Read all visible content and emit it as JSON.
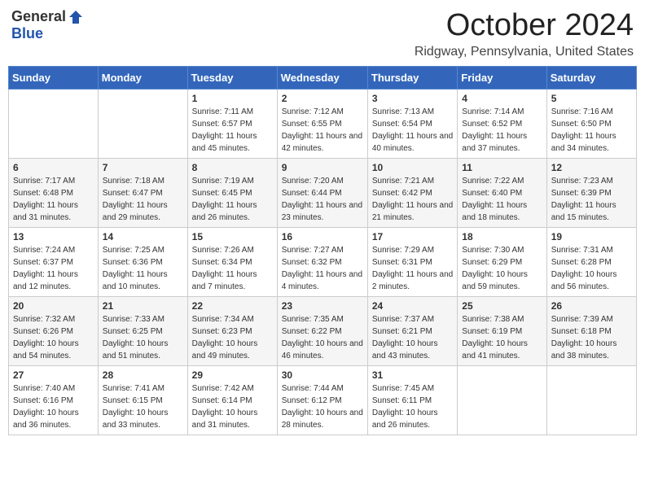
{
  "header": {
    "logo_general": "General",
    "logo_blue": "Blue",
    "month": "October 2024",
    "location": "Ridgway, Pennsylvania, United States"
  },
  "days_of_week": [
    "Sunday",
    "Monday",
    "Tuesday",
    "Wednesday",
    "Thursday",
    "Friday",
    "Saturday"
  ],
  "weeks": [
    [
      {
        "day": "",
        "sunrise": "",
        "sunset": "",
        "daylight": ""
      },
      {
        "day": "",
        "sunrise": "",
        "sunset": "",
        "daylight": ""
      },
      {
        "day": "1",
        "sunrise": "Sunrise: 7:11 AM",
        "sunset": "Sunset: 6:57 PM",
        "daylight": "Daylight: 11 hours and 45 minutes."
      },
      {
        "day": "2",
        "sunrise": "Sunrise: 7:12 AM",
        "sunset": "Sunset: 6:55 PM",
        "daylight": "Daylight: 11 hours and 42 minutes."
      },
      {
        "day": "3",
        "sunrise": "Sunrise: 7:13 AM",
        "sunset": "Sunset: 6:54 PM",
        "daylight": "Daylight: 11 hours and 40 minutes."
      },
      {
        "day": "4",
        "sunrise": "Sunrise: 7:14 AM",
        "sunset": "Sunset: 6:52 PM",
        "daylight": "Daylight: 11 hours and 37 minutes."
      },
      {
        "day": "5",
        "sunrise": "Sunrise: 7:16 AM",
        "sunset": "Sunset: 6:50 PM",
        "daylight": "Daylight: 11 hours and 34 minutes."
      }
    ],
    [
      {
        "day": "6",
        "sunrise": "Sunrise: 7:17 AM",
        "sunset": "Sunset: 6:48 PM",
        "daylight": "Daylight: 11 hours and 31 minutes."
      },
      {
        "day": "7",
        "sunrise": "Sunrise: 7:18 AM",
        "sunset": "Sunset: 6:47 PM",
        "daylight": "Daylight: 11 hours and 29 minutes."
      },
      {
        "day": "8",
        "sunrise": "Sunrise: 7:19 AM",
        "sunset": "Sunset: 6:45 PM",
        "daylight": "Daylight: 11 hours and 26 minutes."
      },
      {
        "day": "9",
        "sunrise": "Sunrise: 7:20 AM",
        "sunset": "Sunset: 6:44 PM",
        "daylight": "Daylight: 11 hours and 23 minutes."
      },
      {
        "day": "10",
        "sunrise": "Sunrise: 7:21 AM",
        "sunset": "Sunset: 6:42 PM",
        "daylight": "Daylight: 11 hours and 21 minutes."
      },
      {
        "day": "11",
        "sunrise": "Sunrise: 7:22 AM",
        "sunset": "Sunset: 6:40 PM",
        "daylight": "Daylight: 11 hours and 18 minutes."
      },
      {
        "day": "12",
        "sunrise": "Sunrise: 7:23 AM",
        "sunset": "Sunset: 6:39 PM",
        "daylight": "Daylight: 11 hours and 15 minutes."
      }
    ],
    [
      {
        "day": "13",
        "sunrise": "Sunrise: 7:24 AM",
        "sunset": "Sunset: 6:37 PM",
        "daylight": "Daylight: 11 hours and 12 minutes."
      },
      {
        "day": "14",
        "sunrise": "Sunrise: 7:25 AM",
        "sunset": "Sunset: 6:36 PM",
        "daylight": "Daylight: 11 hours and 10 minutes."
      },
      {
        "day": "15",
        "sunrise": "Sunrise: 7:26 AM",
        "sunset": "Sunset: 6:34 PM",
        "daylight": "Daylight: 11 hours and 7 minutes."
      },
      {
        "day": "16",
        "sunrise": "Sunrise: 7:27 AM",
        "sunset": "Sunset: 6:32 PM",
        "daylight": "Daylight: 11 hours and 4 minutes."
      },
      {
        "day": "17",
        "sunrise": "Sunrise: 7:29 AM",
        "sunset": "Sunset: 6:31 PM",
        "daylight": "Daylight: 11 hours and 2 minutes."
      },
      {
        "day": "18",
        "sunrise": "Sunrise: 7:30 AM",
        "sunset": "Sunset: 6:29 PM",
        "daylight": "Daylight: 10 hours and 59 minutes."
      },
      {
        "day": "19",
        "sunrise": "Sunrise: 7:31 AM",
        "sunset": "Sunset: 6:28 PM",
        "daylight": "Daylight: 10 hours and 56 minutes."
      }
    ],
    [
      {
        "day": "20",
        "sunrise": "Sunrise: 7:32 AM",
        "sunset": "Sunset: 6:26 PM",
        "daylight": "Daylight: 10 hours and 54 minutes."
      },
      {
        "day": "21",
        "sunrise": "Sunrise: 7:33 AM",
        "sunset": "Sunset: 6:25 PM",
        "daylight": "Daylight: 10 hours and 51 minutes."
      },
      {
        "day": "22",
        "sunrise": "Sunrise: 7:34 AM",
        "sunset": "Sunset: 6:23 PM",
        "daylight": "Daylight: 10 hours and 49 minutes."
      },
      {
        "day": "23",
        "sunrise": "Sunrise: 7:35 AM",
        "sunset": "Sunset: 6:22 PM",
        "daylight": "Daylight: 10 hours and 46 minutes."
      },
      {
        "day": "24",
        "sunrise": "Sunrise: 7:37 AM",
        "sunset": "Sunset: 6:21 PM",
        "daylight": "Daylight: 10 hours and 43 minutes."
      },
      {
        "day": "25",
        "sunrise": "Sunrise: 7:38 AM",
        "sunset": "Sunset: 6:19 PM",
        "daylight": "Daylight: 10 hours and 41 minutes."
      },
      {
        "day": "26",
        "sunrise": "Sunrise: 7:39 AM",
        "sunset": "Sunset: 6:18 PM",
        "daylight": "Daylight: 10 hours and 38 minutes."
      }
    ],
    [
      {
        "day": "27",
        "sunrise": "Sunrise: 7:40 AM",
        "sunset": "Sunset: 6:16 PM",
        "daylight": "Daylight: 10 hours and 36 minutes."
      },
      {
        "day": "28",
        "sunrise": "Sunrise: 7:41 AM",
        "sunset": "Sunset: 6:15 PM",
        "daylight": "Daylight: 10 hours and 33 minutes."
      },
      {
        "day": "29",
        "sunrise": "Sunrise: 7:42 AM",
        "sunset": "Sunset: 6:14 PM",
        "daylight": "Daylight: 10 hours and 31 minutes."
      },
      {
        "day": "30",
        "sunrise": "Sunrise: 7:44 AM",
        "sunset": "Sunset: 6:12 PM",
        "daylight": "Daylight: 10 hours and 28 minutes."
      },
      {
        "day": "31",
        "sunrise": "Sunrise: 7:45 AM",
        "sunset": "Sunset: 6:11 PM",
        "daylight": "Daylight: 10 hours and 26 minutes."
      },
      {
        "day": "",
        "sunrise": "",
        "sunset": "",
        "daylight": ""
      },
      {
        "day": "",
        "sunrise": "",
        "sunset": "",
        "daylight": ""
      }
    ]
  ]
}
